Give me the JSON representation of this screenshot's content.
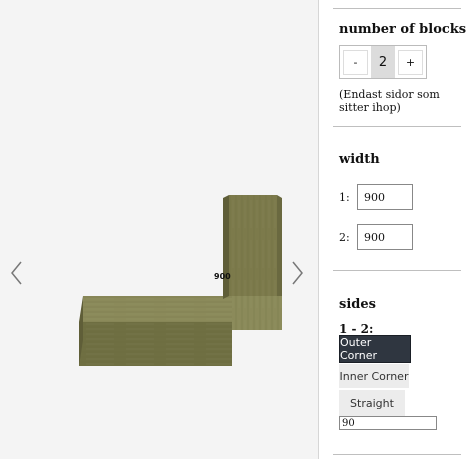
{
  "viewer": {
    "dimension_label": "900",
    "prev_icon": "chevron-left-icon",
    "next_icon": "chevron-right-icon",
    "wood_colors": {
      "top": "#8b8a5a",
      "front": "#6f6f42",
      "side": "#7c7a4b",
      "grain": "#5e5d38"
    }
  },
  "panel": {
    "blocks": {
      "heading": "number of blocks",
      "minus_label": "-",
      "count": "2",
      "plus_label": "+",
      "note": "(Endast sidor som sitter ihop)"
    },
    "width": {
      "heading": "width",
      "fields": [
        {
          "label": "1:",
          "value": "900"
        },
        {
          "label": "2:",
          "value": "900"
        }
      ]
    },
    "sides": {
      "heading": "sides",
      "pair_label": "1 - 2:",
      "options": [
        "Outer Corner",
        "Inner Corner",
        "Straight"
      ],
      "selected": "Outer Corner",
      "angle_value": "90"
    },
    "accent_color": "#2f3640"
  }
}
